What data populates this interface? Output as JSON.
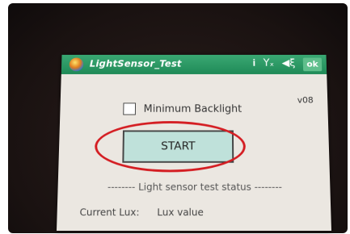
{
  "app": {
    "title": "LightSensor_Test",
    "ok_label": "ok",
    "version": "v08"
  },
  "status_bar": {
    "icons": [
      "signal-icon",
      "network-off-icon",
      "speaker-icon"
    ],
    "signal_glyph": "𝐢",
    "network_glyph": "Yₓ",
    "speaker_glyph": "◀ξ"
  },
  "options": {
    "minimum_backlight_label": "Minimum Backlight",
    "minimum_backlight_checked": false
  },
  "actions": {
    "start_label": "START"
  },
  "status_section": {
    "header": "-------- Light sensor test status --------",
    "current_lux_label": "Current Lux:",
    "current_lux_value": "Lux value"
  },
  "colors": {
    "title_bar": "#1f8a57",
    "start_button_fill": "#bfe1da",
    "highlight": "#d41d22",
    "screen_bg": "#ebe7e1"
  }
}
